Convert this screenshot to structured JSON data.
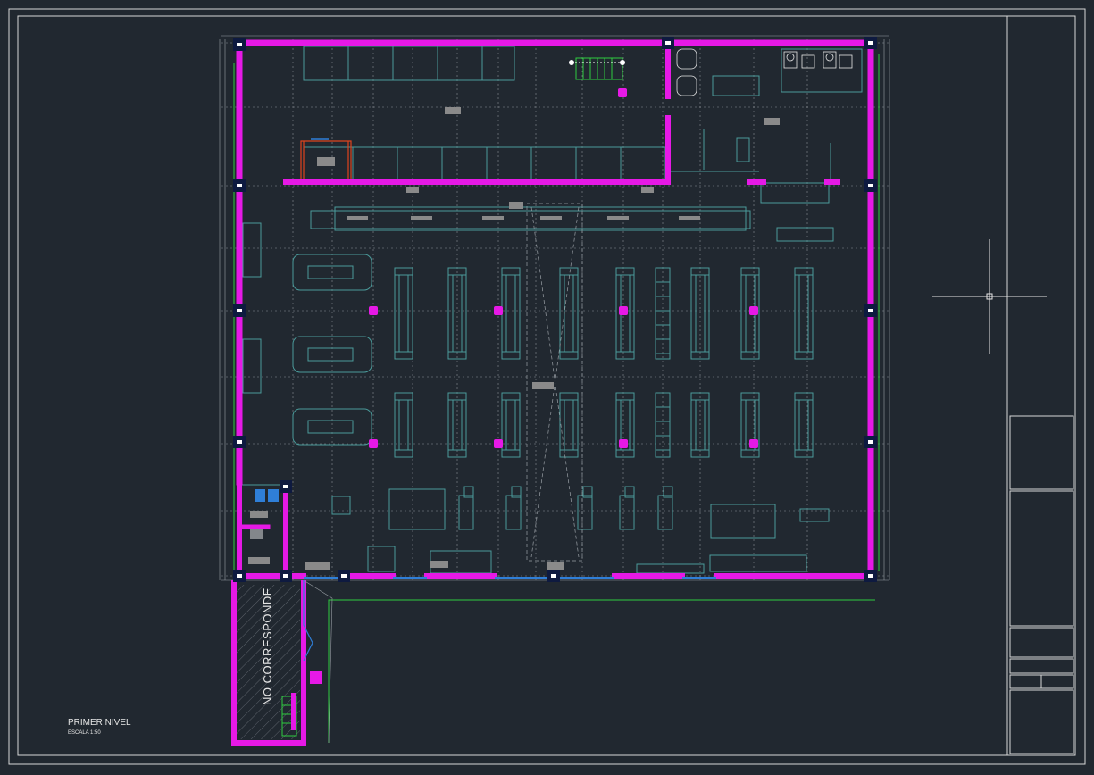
{
  "drawing": {
    "title": "PRIMER NIVEL",
    "scale": "ESCALA 1:50",
    "hatch_label": "NO CORRESPONDE"
  },
  "colors": {
    "background": "#212830",
    "wall": "#e619e6",
    "furniture": "#4a9a9a",
    "grid": "#8a8f96",
    "column": "#0e1a40",
    "frame": "#d8d8d8",
    "cad_red": "#e0441c",
    "cad_green": "#2ecc40",
    "cad_blue": "#2f7fd8",
    "equipment": "#8a8a8a"
  },
  "icons": {
    "crosshair": "crosshair-cursor-icon"
  }
}
